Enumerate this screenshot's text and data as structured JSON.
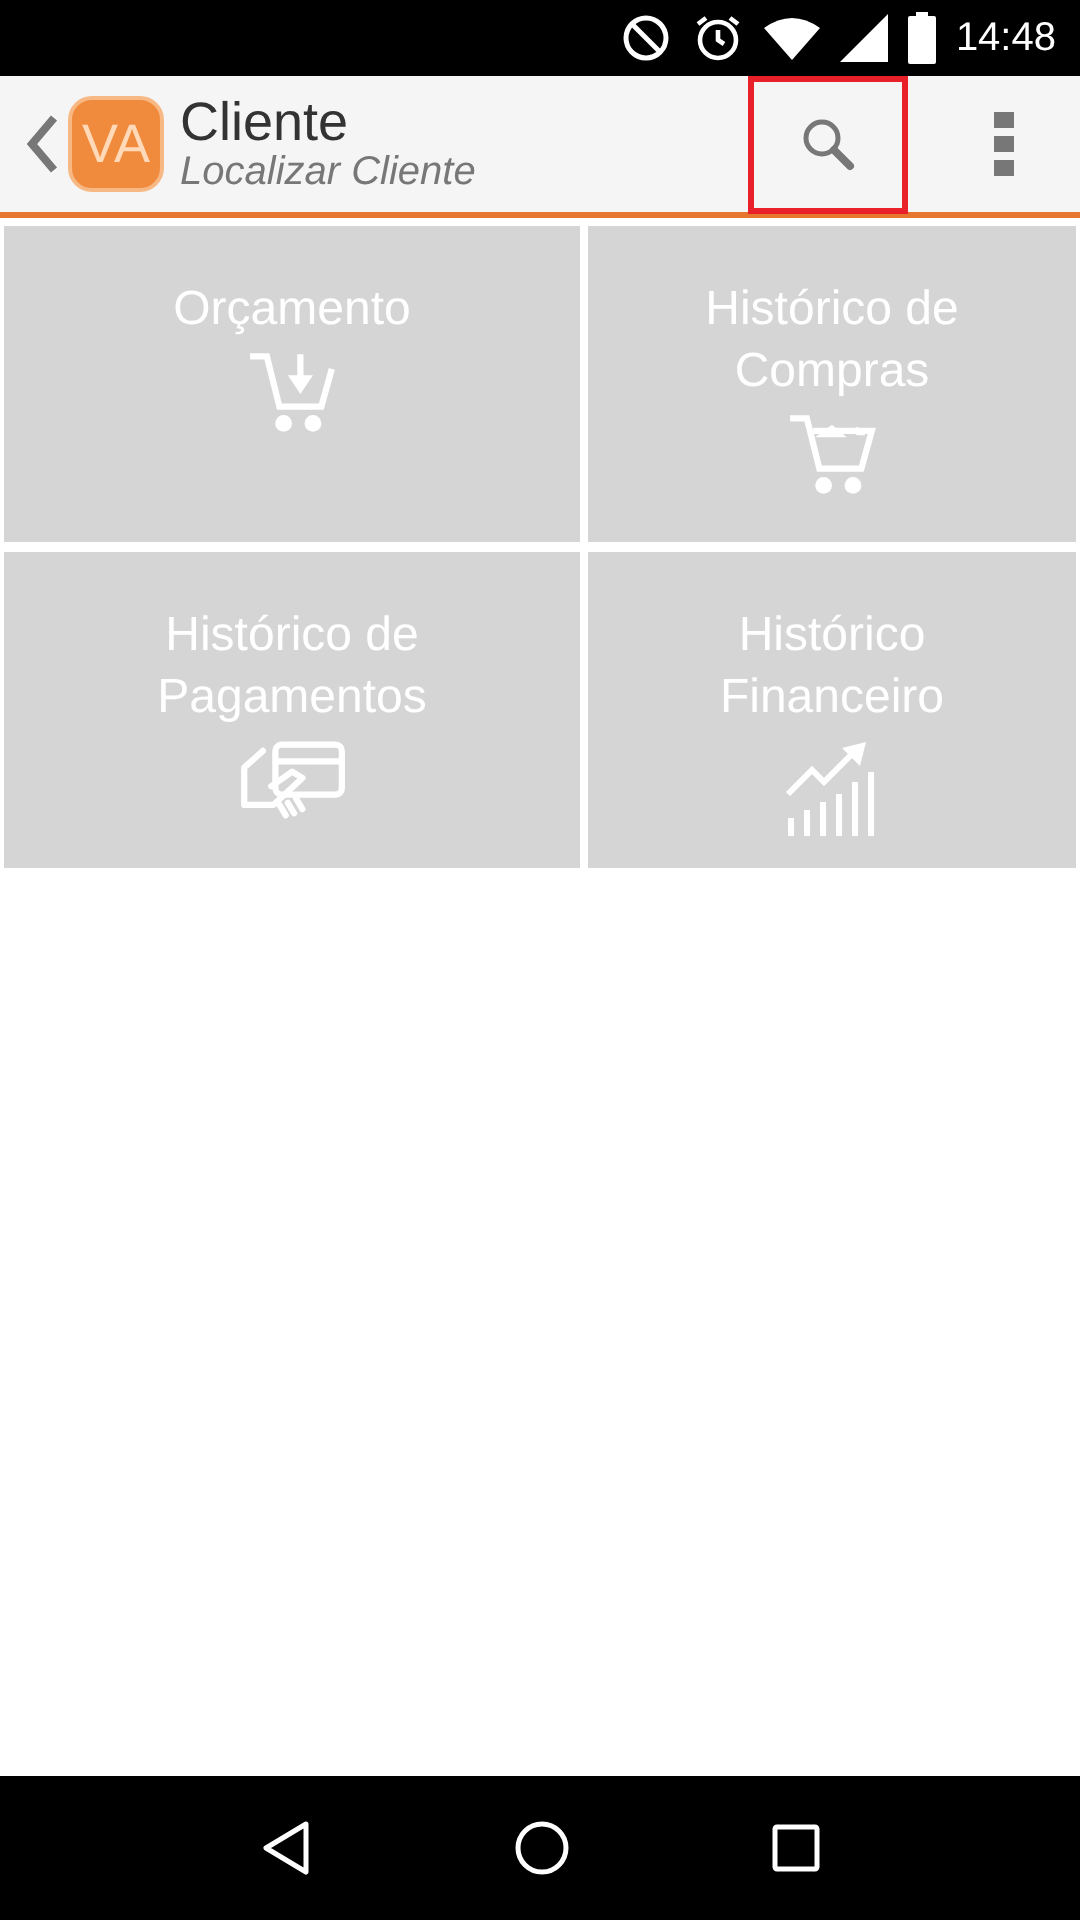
{
  "status_bar": {
    "time": "14:48"
  },
  "app_bar": {
    "logo": "VA",
    "title": "Cliente",
    "subtitle": "Localizar Cliente",
    "search": {
      "highlighted": true
    }
  },
  "tiles": [
    {
      "label": "Orçamento",
      "kind": "cart-down"
    },
    {
      "label": "Histórico de Compras",
      "kind": "cart-full"
    },
    {
      "label": "Histórico de Pagamentos",
      "kind": "card-hand"
    },
    {
      "label": "Histórico Financeiro",
      "kind": "chart-up"
    }
  ]
}
